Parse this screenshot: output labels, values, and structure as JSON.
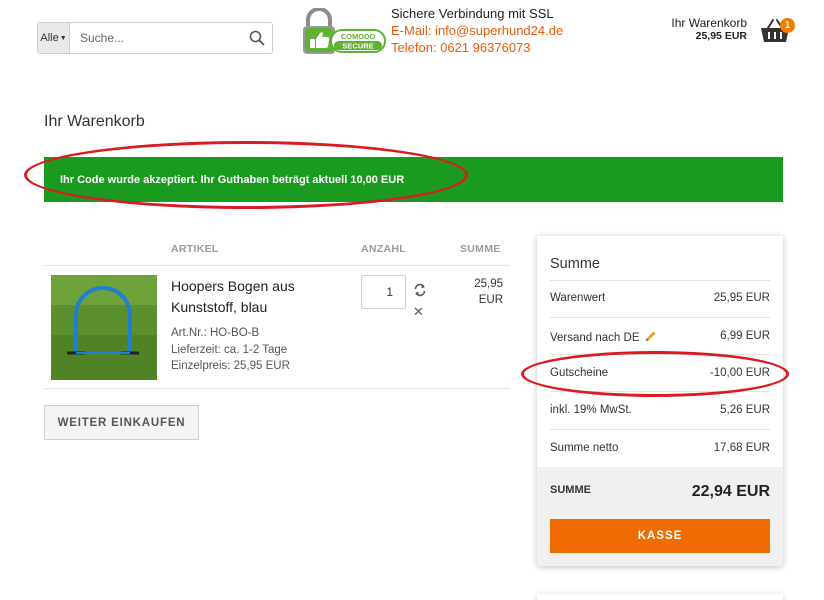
{
  "header": {
    "search": {
      "category": "Alle",
      "placeholder": "Suche..."
    },
    "ssl": {
      "badge_top": "COMODO",
      "badge_bottom": "SECURE",
      "line1": "Sichere Verbindung mit SSL",
      "email": "E-Mail: info@superhund24.de",
      "phone": "Telefon: 0621 96376073"
    },
    "cart": {
      "label": "Ihr Warenkorb",
      "amount": "25,95 EUR",
      "count": "1"
    }
  },
  "page": {
    "title": "Ihr Warenkorb",
    "alert": "Ihr Code wurde akzeptiert. Ihr Guthaben beträgt aktuell 10,00 EUR"
  },
  "table": {
    "headers": {
      "article": "ARTIKEL",
      "quantity": "ANZAHL",
      "sum": "SUMME"
    },
    "item": {
      "name": "Hoopers Bogen aus Kunststoff, blau",
      "article_no": "Art.Nr.: HO-BO-B",
      "delivery": "Lieferzeit: ca. 1-2 Tage",
      "unit_price": "Einzelpreis: 25,95 EUR",
      "quantity": "1",
      "sum_value": "25,95",
      "sum_currency": "EUR"
    },
    "continue_button": "WEITER EINKAUFEN"
  },
  "summary": {
    "title": "Summe",
    "rows": [
      {
        "label": "Warenwert",
        "value": "25,95 EUR"
      },
      {
        "label": "Versand nach DE",
        "value": "6,99 EUR"
      },
      {
        "label": "Gutscheine",
        "value": "-10,00 EUR"
      },
      {
        "label": "inkl. 19% MwSt.",
        "value": "5,26 EUR"
      },
      {
        "label": "Summe netto",
        "value": "17,68 EUR"
      }
    ],
    "total_label": "SUMME",
    "total_value": "22,94 EUR",
    "checkout_button": "KASSE"
  },
  "colors": {
    "accent_orange": "#ef6c00",
    "success_green": "#1a9a1e",
    "annotation_red": "#d91c24"
  },
  "icons": [
    "chevron-down-icon",
    "search-icon",
    "padlock-icon",
    "thumbs-up-icon",
    "basket-icon",
    "refresh-icon",
    "close-icon",
    "pencil-icon"
  ]
}
